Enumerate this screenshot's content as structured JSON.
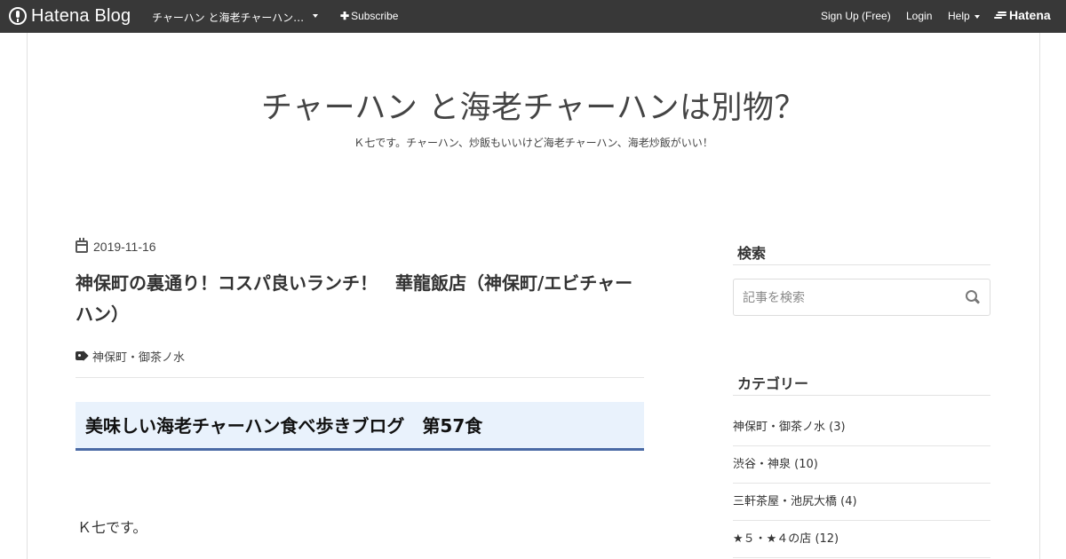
{
  "topbar": {
    "logo_text": "Hatena Blog",
    "blog_name": "チャーハン と海老チャーハン…",
    "subscribe_label": "Subscribe",
    "signup_label": "Sign Up (Free)",
    "login_label": "Login",
    "help_label": "Help",
    "hatena_label": "Hatena"
  },
  "header": {
    "title": "チャーハン と海老チャーハンは別物？",
    "description": "Ｋ七です。チャーハン、炒飯もいいけど海老チャーハン、海老炒飯がいい！"
  },
  "article": {
    "date": "2019-11-16",
    "title": "神保町の裏通り！コスパ良いランチ！　華龍飯店（神保町/エビチャーハン）",
    "tag": "神保町・御茶ノ水",
    "section_heading": "美味しい海老チャーハン食べ歩きブログ　第57食",
    "first_paragraph": "Ｋ七です。"
  },
  "sidebar": {
    "search": {
      "heading": "検索",
      "placeholder": "記事を検索"
    },
    "categories": {
      "heading": "カテゴリー",
      "items": [
        {
          "label": "神保町・御茶ノ水 (3)"
        },
        {
          "label": "渋谷・神泉 (10)"
        },
        {
          "label": "三軒茶屋・池尻大橋 (4)"
        },
        {
          "label": "★５・★４の店 (12)"
        }
      ]
    }
  }
}
